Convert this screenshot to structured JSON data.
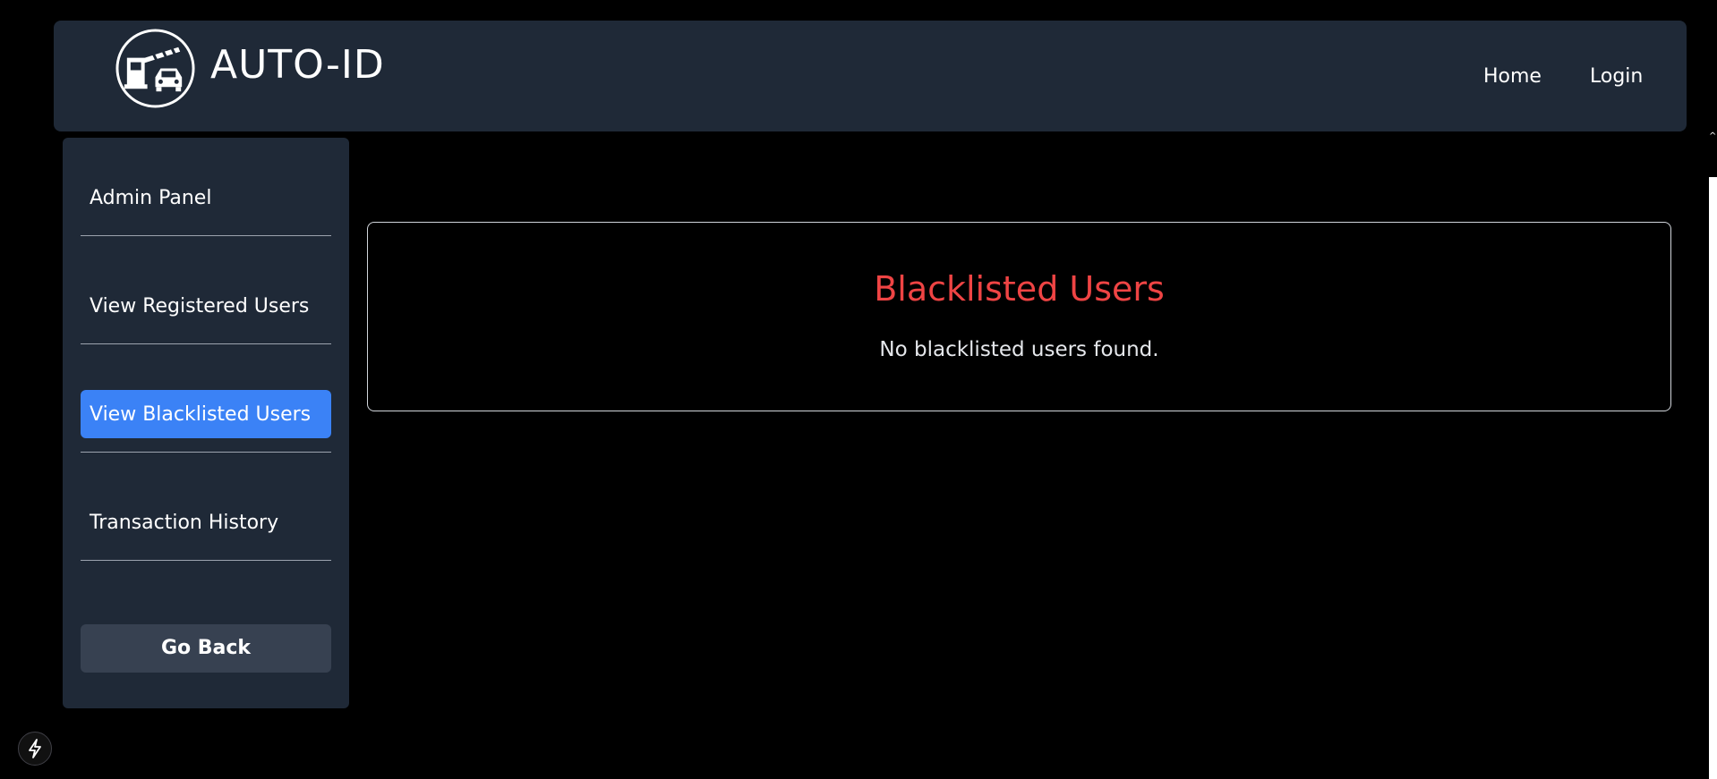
{
  "brand": {
    "name": "AUTO-ID",
    "logo_icon": "toll-gate-car-icon"
  },
  "nav": {
    "home": "Home",
    "login": "Login"
  },
  "sidebar": {
    "items": [
      {
        "label": "Admin Panel",
        "active": false
      },
      {
        "label": "View Registered Users",
        "active": false
      },
      {
        "label": "View Blacklisted Users",
        "active": true
      },
      {
        "label": "Transaction History",
        "active": false
      }
    ],
    "go_back": "Go Back"
  },
  "main": {
    "title": "Blacklisted Users",
    "message": "No blacklisted users found."
  },
  "colors": {
    "background": "#000000",
    "panel": "#1f2937",
    "active": "#3b82f6",
    "title_red": "#ef4444",
    "button": "#374151"
  },
  "floating_icon": "lightning-bolt-icon"
}
